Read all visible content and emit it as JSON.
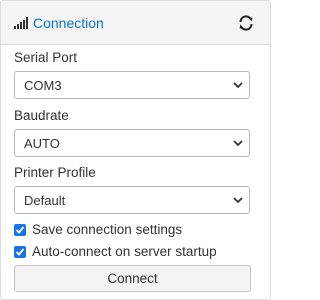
{
  "header": {
    "title": "Connection",
    "signal_icon": "signal-bars-icon",
    "refresh_icon": "refresh-icon"
  },
  "fields": {
    "serial_port": {
      "label": "Serial Port",
      "value": "COM3"
    },
    "baudrate": {
      "label": "Baudrate",
      "value": "AUTO"
    },
    "printer_profile": {
      "label": "Printer Profile",
      "value": "Default"
    }
  },
  "options": {
    "save_settings": {
      "label": "Save connection settings",
      "checked": true
    },
    "auto_connect": {
      "label": "Auto-connect on server startup",
      "checked": true
    }
  },
  "actions": {
    "connect_label": "Connect"
  },
  "colors": {
    "accent": "#0a74c9",
    "checkbox": "#1a73e8"
  }
}
